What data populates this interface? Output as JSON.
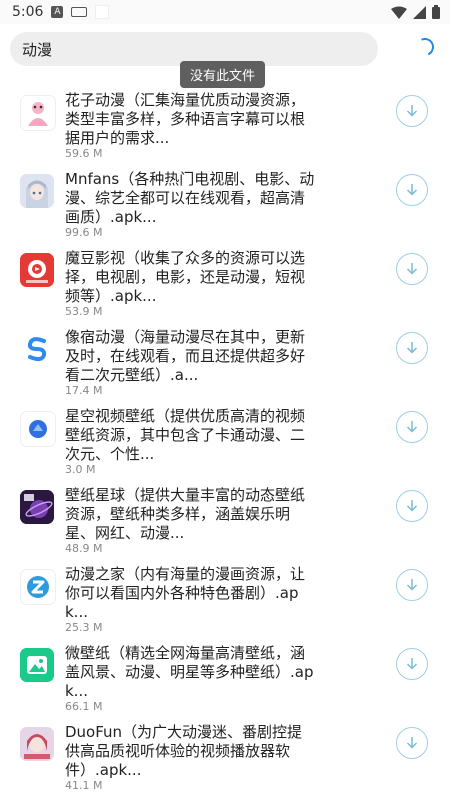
{
  "status_bar": {
    "time": "5:06",
    "notif_a": "A"
  },
  "search": {
    "query": "动漫"
  },
  "toast": {
    "text": "没有此文件"
  },
  "items": [
    {
      "title": "花子动漫（汇集海量优质动漫资源，类型丰富多样，多种语言字幕可以根据用户的需求...",
      "size": "59.6 M",
      "icon": "hanazi-anime-app-icon"
    },
    {
      "title": "Mnfans（各种热门电视剧、电影、动漫、综艺全都可以在线观看，超高清画质）.apk...",
      "size": "99.6 M",
      "icon": "mnfans-app-icon"
    },
    {
      "title": "魔豆影视（收集了众多的资源可以选择，电视剧，电影，还是动漫，短视频等）.apk...",
      "size": "53.9 M",
      "icon": "modou-video-app-icon"
    },
    {
      "title": "像宿动漫（海量动漫尽在其中，更新及时，在线观看，而且还提供超多好看二次元壁纸）.a...",
      "size": "17.4 M",
      "icon": "xiangsu-anime-app-icon"
    },
    {
      "title": "星空视频壁纸（提供优质高清的视频壁纸资源，其中包含了卡通动漫、二次元、个性...",
      "size": "3.0 M",
      "icon": "starry-wallpaper-app-icon"
    },
    {
      "title": "壁纸星球（提供大量丰富的动态壁纸资源，壁纸种类多样，涵盖娱乐明星、网红、动漫...",
      "size": "48.9 M",
      "icon": "wallpaper-planet-app-icon"
    },
    {
      "title": "动漫之家（内有海量的漫画资源，让你可以看国内外各种特色番剧）.apk...",
      "size": "25.3 M",
      "icon": "dmzj-app-icon"
    },
    {
      "title": "微壁纸（精选全网海量高清壁纸，涵盖风景、动漫、明星等多种壁纸）.apk...",
      "size": "66.1 M",
      "icon": "wei-wallpaper-app-icon"
    },
    {
      "title": "DuoFun（为广大动漫迷、番剧控提供高品质视听体验的视频播放器软件）.apk...",
      "size": "41.1 M",
      "icon": "duofun-app-icon"
    }
  ],
  "colors": {
    "accent": "#1e88e5",
    "download_ring": "#9ecfe3",
    "search_bg": "#eeeeee"
  }
}
